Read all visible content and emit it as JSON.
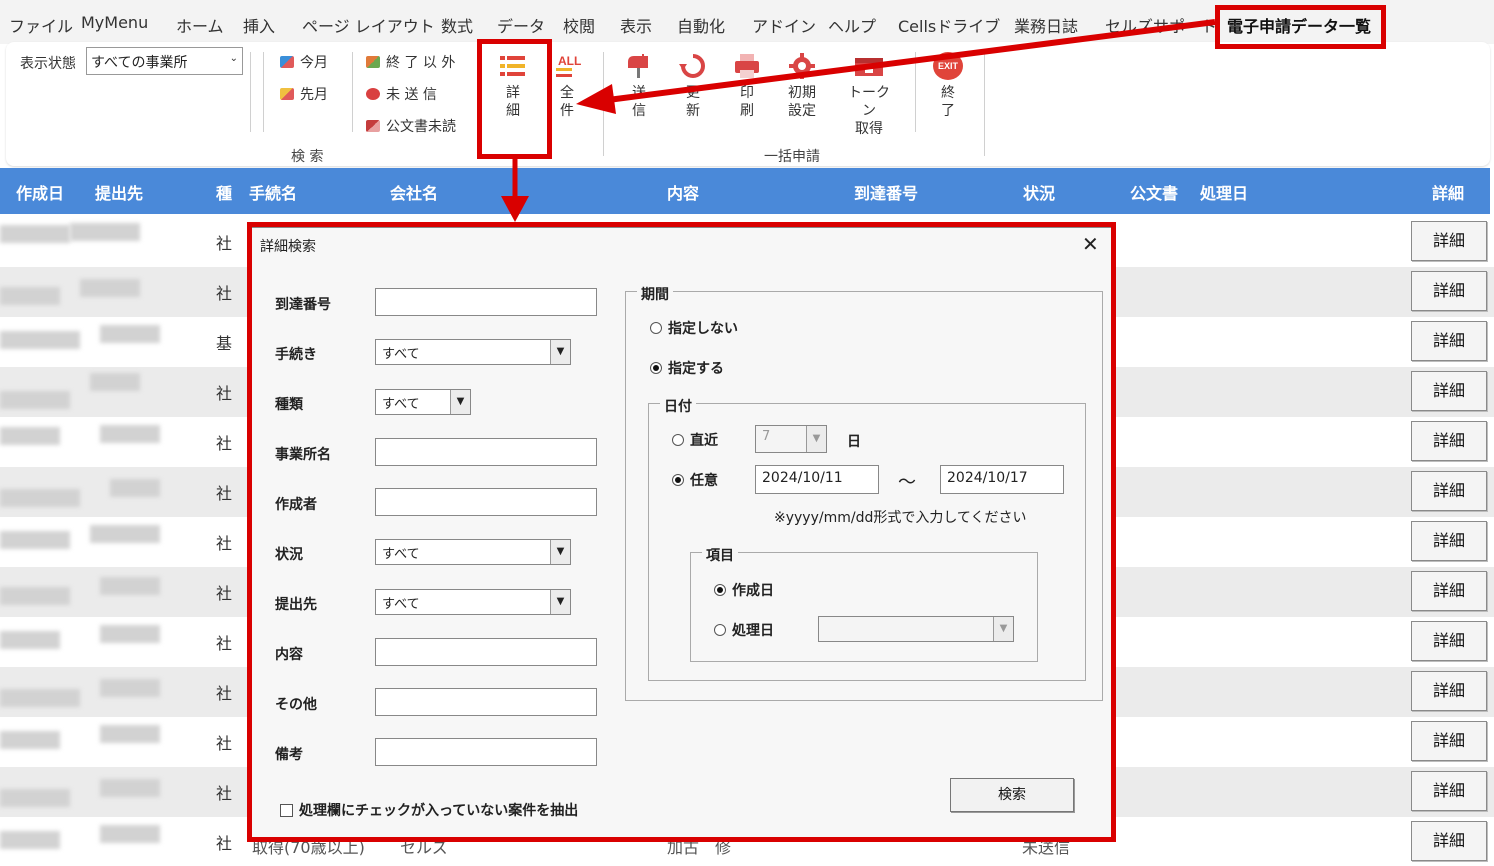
{
  "menu": {
    "tabs": [
      {
        "label": "ファイル",
        "active": false
      },
      {
        "label": "MyMenu",
        "active": false
      },
      {
        "label": "ホーム",
        "active": false
      },
      {
        "label": "挿入",
        "active": false
      },
      {
        "label": "ページ レイアウト",
        "active": false
      },
      {
        "label": "数式",
        "active": false
      },
      {
        "label": "データ",
        "active": false
      },
      {
        "label": "校閲",
        "active": false
      },
      {
        "label": "表示",
        "active": false
      },
      {
        "label": "自動化",
        "active": false
      },
      {
        "label": "アドイン",
        "active": false
      },
      {
        "label": "ヘルプ",
        "active": false
      },
      {
        "label": "Cellsドライブ",
        "active": false
      },
      {
        "label": "業務日誌",
        "active": false
      },
      {
        "label": "セルズサポート",
        "active": false
      },
      {
        "label": "電子申請データ一覧",
        "active": true
      }
    ]
  },
  "ribbon": {
    "display_state_label": "表示状態",
    "display_state_value": "すべての事業所",
    "this_month": "今月",
    "last_month": "先月",
    "not_finished": "終 了 以 外",
    "not_sent": "未 送 信",
    "unread_docs": "公文書未読",
    "detail": [
      "詳",
      "細"
    ],
    "all": [
      "全",
      "件"
    ],
    "send": [
      "送",
      "信"
    ],
    "update": [
      "更",
      "新"
    ],
    "print": [
      "印",
      "刷"
    ],
    "initial_settings": [
      "初期",
      "設定"
    ],
    "token": [
      "トークン",
      "取得"
    ],
    "exit": [
      "終",
      "了"
    ],
    "exit_icon_text": "EXIT",
    "all_icon_text": "ALL",
    "group_search": "検 索",
    "group_batch": "一括申請"
  },
  "table": {
    "headers": [
      "作成日",
      "提出先",
      "種",
      "手続名",
      "会社名",
      "内容",
      "到達番号",
      "状況",
      "公文書",
      "処理日",
      "詳細"
    ],
    "rows": [
      {
        "kind": "社",
        "button": "詳細"
      },
      {
        "kind": "社",
        "button": "詳細"
      },
      {
        "kind": "基",
        "button": "詳細"
      },
      {
        "kind": "社",
        "button": "詳細"
      },
      {
        "kind": "社",
        "button": "詳細"
      },
      {
        "kind": "社",
        "button": "詳細"
      },
      {
        "kind": "社",
        "button": "詳細"
      },
      {
        "kind": "社",
        "button": "詳細"
      },
      {
        "kind": "社",
        "button": "詳細"
      },
      {
        "kind": "社",
        "button": "詳細"
      },
      {
        "kind": "社",
        "button": "詳細"
      },
      {
        "kind": "社",
        "button": "詳細"
      },
      {
        "kind": "社",
        "button": "詳細"
      }
    ],
    "last_row_fragments": [
      "取得(70歳以上)",
      "セルズ",
      "加古　修",
      "未送信"
    ]
  },
  "dialog": {
    "title": "詳細検索",
    "close": "✕",
    "fields": {
      "arrival_number": {
        "label": "到達番号",
        "value": ""
      },
      "procedure": {
        "label": "手続き",
        "value": "すべて"
      },
      "type": {
        "label": "種類",
        "value": "すべて"
      },
      "office_name": {
        "label": "事業所名",
        "value": ""
      },
      "creator": {
        "label": "作成者",
        "value": ""
      },
      "status": {
        "label": "状況",
        "value": "すべて"
      },
      "submit_to": {
        "label": "提出先",
        "value": "すべて"
      },
      "content": {
        "label": "内容",
        "value": ""
      },
      "other": {
        "label": "その他",
        "value": ""
      },
      "remarks": {
        "label": "備考",
        "value": ""
      }
    },
    "period": {
      "title": "期間",
      "none": "指定しない",
      "specify": "指定する",
      "selected": "指定する"
    },
    "date": {
      "title": "日付",
      "recent": "直近",
      "recent_value": "7",
      "day_unit": "日",
      "any": "任意",
      "selected": "任意",
      "from": "2024/10/11",
      "tilde": "～",
      "to": "2024/10/17",
      "note": "※yyyy/mm/dd形式で入力してください"
    },
    "item": {
      "title": "項目",
      "created": "作成日",
      "processed": "処理日",
      "selected": "作成日",
      "processed_value": ""
    },
    "checkbox_label": "処理欄にチェックが入っていない案件を抽出",
    "checkbox_checked": false,
    "search_button": "検索"
  },
  "colors": {
    "header_blue": "#4a89d9",
    "annotation_red": "#d90000",
    "active_tab_underline": "#1e7145"
  }
}
